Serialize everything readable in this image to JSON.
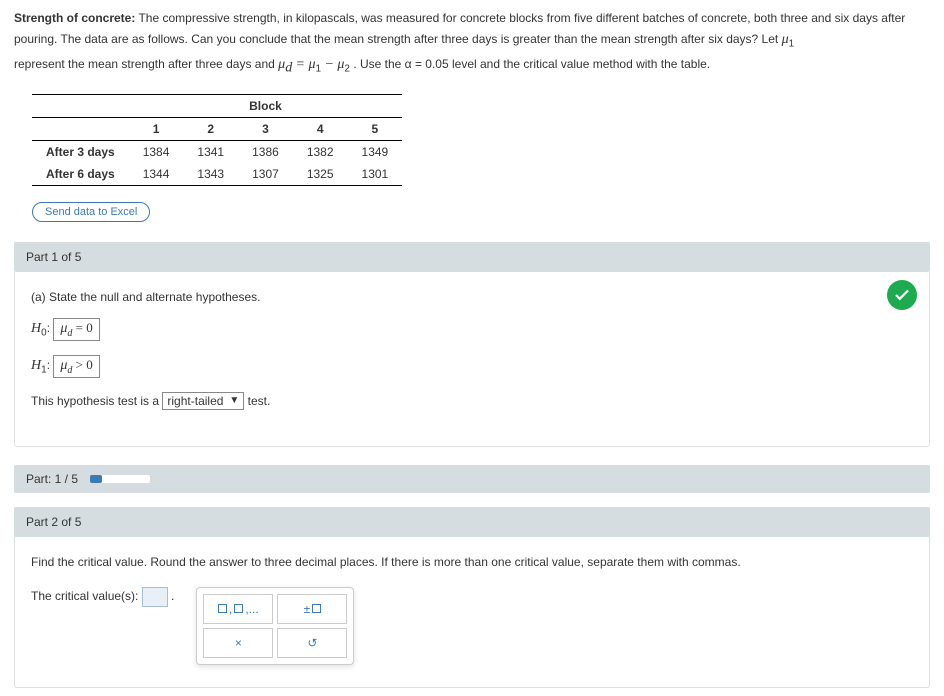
{
  "problem": {
    "title": "Strength of concrete:",
    "body1": "The compressive strength, in kilopascals, was measured for concrete blocks from five different batches of concrete, both three and six days after pouring. The data are as follows. Can you conclude that the mean strength after three days is greater than the mean strength after six days? Let ",
    "mu1": "μ",
    "mu1_sub": "1",
    "body2": "represent the mean strength after three days and ",
    "eqn": "μ",
    "eqn_sub_d": "d",
    "eq_text": " = μ",
    "eqn_sub_1": "1",
    "minus": " − μ",
    "eqn_sub_2": "2",
    "body3": ". Use the α = 0.05 level and the critical value method with the table."
  },
  "table": {
    "super_header": "Block",
    "cols": [
      "1",
      "2",
      "3",
      "4",
      "5"
    ],
    "rows": [
      {
        "label": "After 3 days",
        "vals": [
          "1384",
          "1341",
          "1386",
          "1382",
          "1349"
        ]
      },
      {
        "label": "After 6 days",
        "vals": [
          "1344",
          "1343",
          "1307",
          "1325",
          "1301"
        ]
      }
    ]
  },
  "send_excel": "Send data to Excel",
  "part1": {
    "bar": "Part 1 of 5",
    "prompt": "(a) State the null and alternate hypotheses.",
    "H0_label": "H",
    "H0_sub": "0",
    "H0_val": "μ_d = 0",
    "H1_label": "H",
    "H1_sub": "1",
    "H1_val": "μ_d > 0",
    "sentence_a": "This hypothesis test is a ",
    "tail_value": "right-tailed",
    "sentence_b": " test."
  },
  "progress": {
    "label": "Part: 1 / 5"
  },
  "part2": {
    "bar": "Part 2 of 5",
    "prompt": "Find the critical value. Round the answer to three decimal places. If there is more than one critical value, separate them with commas.",
    "cv_label": "The critical value(s): ",
    "period": ".",
    "tool_list": "□,□,...",
    "tool_pm": "±□",
    "tool_x": "×",
    "tool_reset": "↺"
  }
}
